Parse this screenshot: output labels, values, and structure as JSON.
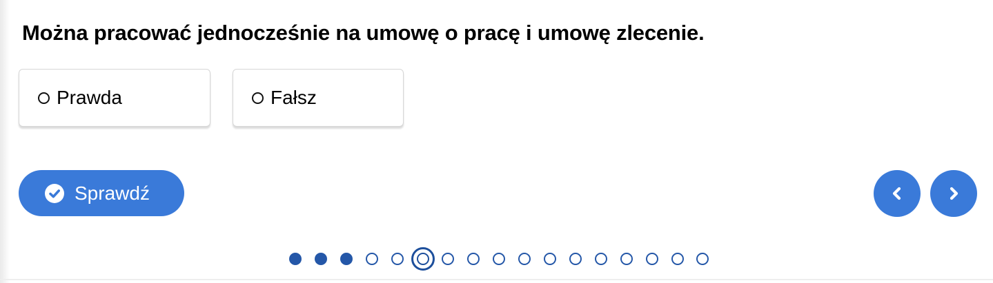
{
  "quiz": {
    "question": "Można pracować jednocześnie na umowę o pracę i umowę zlecenie.",
    "options": [
      {
        "label": "Prawda",
        "selected": false
      },
      {
        "label": "Fałsz",
        "selected": false
      }
    ],
    "check_label": "Sprawdź"
  },
  "pagination": {
    "total": 17,
    "current": 6,
    "states": [
      "done",
      "done",
      "done",
      "todo",
      "todo",
      "current",
      "todo",
      "todo",
      "todo",
      "todo",
      "todo",
      "todo",
      "todo",
      "todo",
      "todo",
      "todo",
      "todo"
    ]
  },
  "icons": {
    "check": "check-circle-icon",
    "prev": "chevron-left-icon",
    "next": "chevron-right-icon"
  },
  "colors": {
    "accent": "#3a7ad9",
    "pager": "#2457a8"
  }
}
